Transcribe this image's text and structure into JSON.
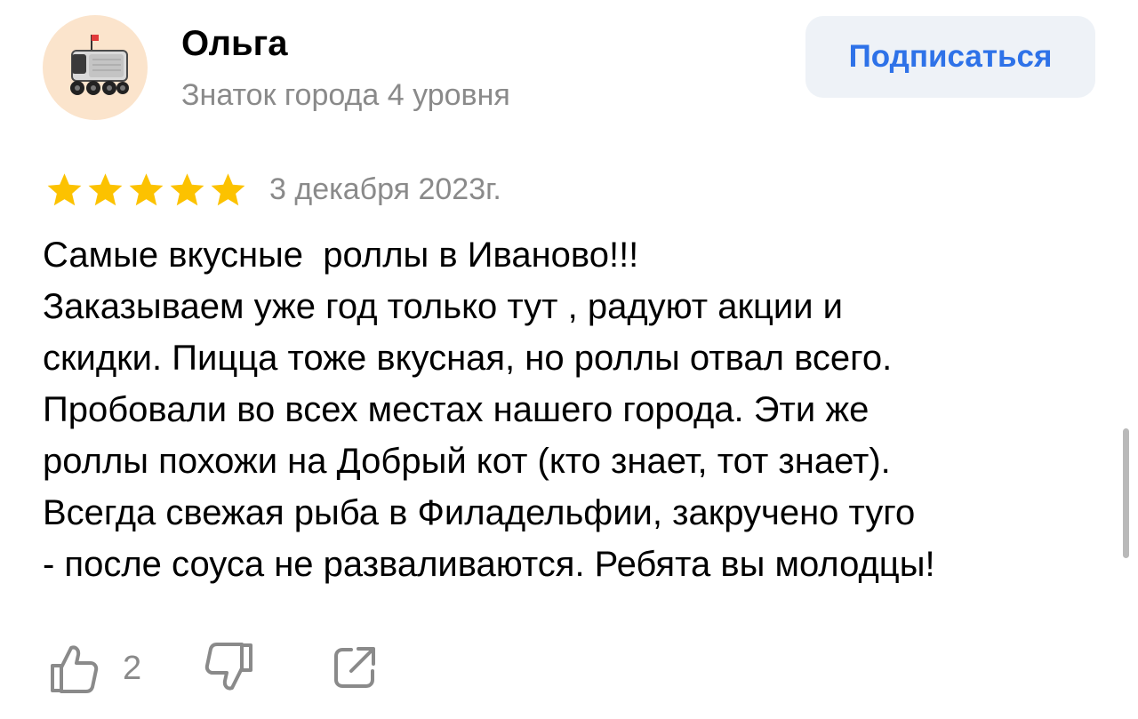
{
  "user": {
    "name": "Ольга",
    "level": "Знаток города 4 уровня",
    "subscribe_label": "Подписаться",
    "avatar_icon": "delivery-robot-icon"
  },
  "review": {
    "rating": 5,
    "rating_max": 5,
    "date": "3 декабря 2023г.",
    "lines": [
      "Самые вкусные  роллы в Иваново!!!",
      "Заказываем уже год только тут , радуют акции и",
      "скидки. Пицца тоже вкусная, но роллы отвал всего.",
      "Пробовали во всех местах нашего города. Эти же",
      "роллы похожи на Добрый кот (кто знает, тот знает).",
      "Всегда свежая рыба в Филадельфии, закручено туго",
      "- после соуса не разваливаются. Ребята вы молодцы!"
    ]
  },
  "actions": {
    "like_count": "2",
    "like_icon": "thumbs-up-icon",
    "dislike_icon": "thumbs-down-icon",
    "share_icon": "share-icon"
  },
  "colors": {
    "star": "#fcc200",
    "accent": "#2e72e8",
    "muted_text": "#8a8a8a",
    "button_bg": "#eef2f7",
    "avatar_bg": "#fbe4cc"
  }
}
